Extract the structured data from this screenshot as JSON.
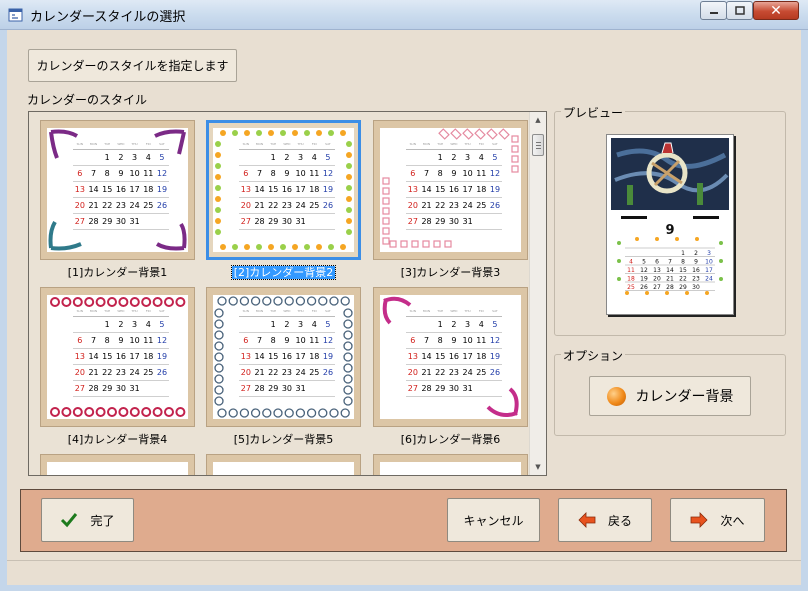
{
  "window": {
    "title": "カレンダースタイルの選択",
    "controls": {
      "minimize_icon": "minimize-icon",
      "maximize_icon": "maximize-icon",
      "close_icon": "close-icon"
    }
  },
  "header_button": {
    "label": "カレンダーのスタイルを指定します"
  },
  "style_list": {
    "label": "カレンダーのスタイル",
    "items": [
      {
        "label": "[1]カレンダー背景1",
        "selected": false,
        "decoration": "ribbon-corners"
      },
      {
        "label": "[2]カレンダー背景2",
        "selected": true,
        "decoration": "flower-border"
      },
      {
        "label": "[3]カレンダー背景3",
        "selected": false,
        "decoration": "lace-border"
      },
      {
        "label": "[4]カレンダー背景4",
        "selected": false,
        "decoration": "flower-rows"
      },
      {
        "label": "[5]カレンダー背景5",
        "selected": false,
        "decoration": "chain-border"
      },
      {
        "label": "[6]カレンダー背景6",
        "selected": false,
        "decoration": "ribbon-diagonal"
      }
    ],
    "calendar": {
      "weekdays": [
        "SUN",
        "MON",
        "TUE",
        "WED",
        "THU",
        "FRI",
        "SAT"
      ],
      "rows": [
        [
          "",
          "",
          "1",
          "2",
          "3",
          "4",
          "5"
        ],
        [
          "6",
          "7",
          "8",
          "9",
          "10",
          "11",
          "12"
        ],
        [
          "13",
          "14",
          "15",
          "16",
          "17",
          "18",
          "19"
        ],
        [
          "20",
          "21",
          "22",
          "23",
          "24",
          "25",
          "26"
        ],
        [
          "27",
          "28",
          "29",
          "30",
          "31",
          "",
          ""
        ]
      ]
    }
  },
  "preview": {
    "label": "プレビュー",
    "month": "9",
    "rows": [
      [
        "",
        "",
        "",
        "",
        "1",
        "2",
        "3"
      ],
      [
        "4",
        "5",
        "6",
        "7",
        "8",
        "9",
        "10"
      ],
      [
        "11",
        "12",
        "13",
        "14",
        "15",
        "16",
        "17"
      ],
      [
        "18",
        "19",
        "20",
        "21",
        "22",
        "23",
        "24"
      ],
      [
        "25",
        "26",
        "27",
        "28",
        "29",
        "30",
        ""
      ]
    ]
  },
  "options": {
    "label": "オプション",
    "background_button": "カレンダー背景",
    "icon": "orange-circle-icon"
  },
  "footer": {
    "done": "完了",
    "cancel": "キャンセル",
    "back": "戻る",
    "next": "次へ"
  },
  "colors": {
    "accent_selection": "#3399ff",
    "bottom_bar": "#dfab8e",
    "sunday_red": "#d2201c",
    "saturday_blue": "#213ca8"
  }
}
